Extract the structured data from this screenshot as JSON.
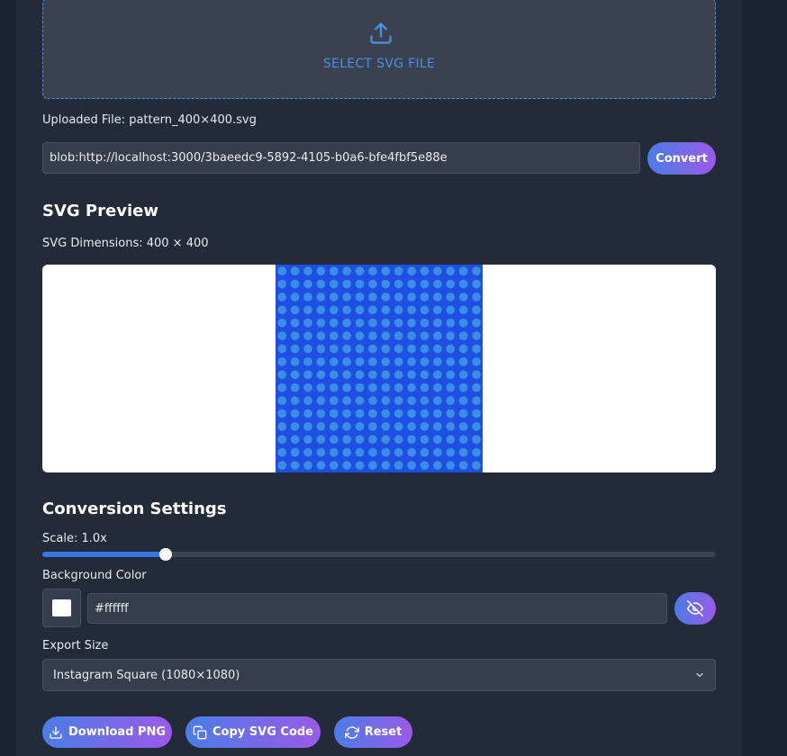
{
  "upload": {
    "button_label": "SELECT SVG FILE",
    "icon": "upload-icon",
    "uploaded_file_text": "Uploaded File: pattern_400×400.svg"
  },
  "url_field": {
    "value": "blob:http://localhost:3000/3baeedc9-5892-4105-b0a6-bfe4fbf5e88e",
    "convert_label": "Convert"
  },
  "preview": {
    "title": "SVG Preview",
    "dimensions_text": "SVG Dimensions: 400 × 400",
    "pattern_color": "#1d4fe0",
    "dot_color": "#3b8de8"
  },
  "settings": {
    "title": "Conversion Settings",
    "scale_label": "Scale: 1.0x",
    "scale_value": 1.0,
    "scale_fraction": 0.183,
    "background_label": "Background Color",
    "background_value": "#ffffff",
    "visibility_icon": "eye-off-icon",
    "export_label": "Export Size",
    "export_selected": "Instagram Square (1080×1080)"
  },
  "actions": {
    "download_label": "Download PNG",
    "copy_label": "Copy SVG Code",
    "reset_label": "Reset"
  },
  "colors": {
    "page_bg": "#1b2230",
    "panel_bg": "#232a38",
    "accent": "#4a90e2",
    "gradient_start": "#4b7de6",
    "gradient_end": "#9a5ae8"
  }
}
